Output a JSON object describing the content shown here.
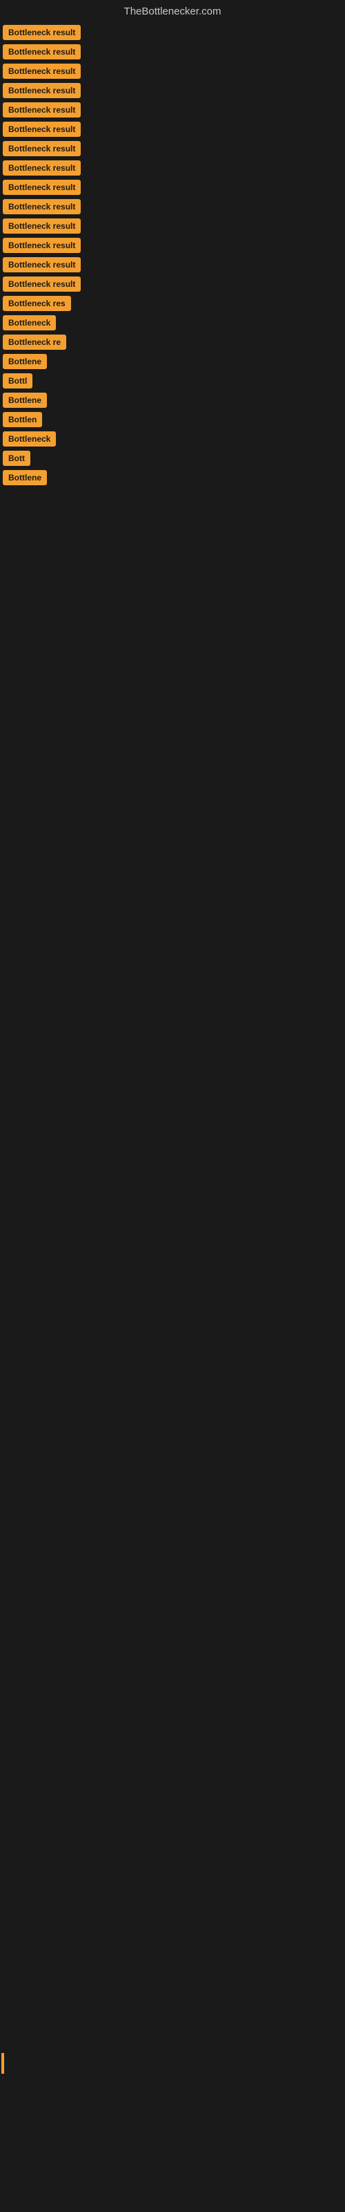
{
  "site": {
    "title": "TheBottlenecker.com"
  },
  "items": [
    {
      "label": "Bottleneck result",
      "size": "full",
      "id": 1
    },
    {
      "label": "Bottleneck result",
      "size": "full",
      "id": 2
    },
    {
      "label": "Bottleneck result",
      "size": "full",
      "id": 3
    },
    {
      "label": "Bottleneck result",
      "size": "full",
      "id": 4
    },
    {
      "label": "Bottleneck result",
      "size": "full",
      "id": 5
    },
    {
      "label": "Bottleneck result",
      "size": "full",
      "id": 6
    },
    {
      "label": "Bottleneck result",
      "size": "full",
      "id": 7
    },
    {
      "label": "Bottleneck result",
      "size": "full",
      "id": 8
    },
    {
      "label": "Bottleneck result",
      "size": "full",
      "id": 9
    },
    {
      "label": "Bottleneck result",
      "size": "full",
      "id": 10
    },
    {
      "label": "Bottleneck result",
      "size": "full",
      "id": 11
    },
    {
      "label": "Bottleneck result",
      "size": "full",
      "id": 12
    },
    {
      "label": "Bottleneck result",
      "size": "full",
      "id": 13
    },
    {
      "label": "Bottleneck result",
      "size": "full",
      "id": 14
    },
    {
      "label": "Bottleneck res",
      "size": "truncated-1",
      "id": 15
    },
    {
      "label": "Bottleneck",
      "size": "truncated-2",
      "id": 16
    },
    {
      "label": "Bottleneck re",
      "size": "truncated-3",
      "id": 17
    },
    {
      "label": "Bottlene",
      "size": "truncated-4",
      "id": 18
    },
    {
      "label": "Bottl",
      "size": "truncated-5",
      "id": 19
    },
    {
      "label": "Bottlene",
      "size": "truncated-4",
      "id": 20
    },
    {
      "label": "Bottlen",
      "size": "truncated-6",
      "id": 21
    },
    {
      "label": "Bottleneck",
      "size": "truncated-2",
      "id": 22
    },
    {
      "label": "Bott",
      "size": "truncated-7",
      "id": 23
    },
    {
      "label": "Bottlene",
      "size": "truncated-4",
      "id": 24
    }
  ]
}
